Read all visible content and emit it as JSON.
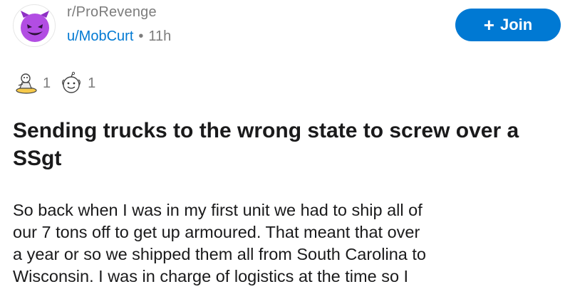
{
  "post": {
    "subreddit": "r/ProRevenge",
    "username": "u/MobCurt",
    "separator": "•",
    "age": "11h",
    "join_label": "Join",
    "join_icon": "+",
    "awards": [
      {
        "icon": "silver-award-icon",
        "count": "1"
      },
      {
        "icon": "wholesome-award-icon",
        "count": "1"
      }
    ],
    "title": "Sending trucks to the wrong state to screw over a SSgt",
    "body_lines": [
      "So back when I was in my first unit we had to ship all of",
      "our 7 tons off to get up armoured. That meant that over",
      "a year or so we shipped them all from South Carolina to",
      "Wisconsin. I was in charge of logistics at the time so I"
    ]
  },
  "colors": {
    "accent": "#0079d3",
    "avatar_face": "#b24de3",
    "meta_text": "#7c7c7c",
    "text": "#1a1a1b"
  }
}
